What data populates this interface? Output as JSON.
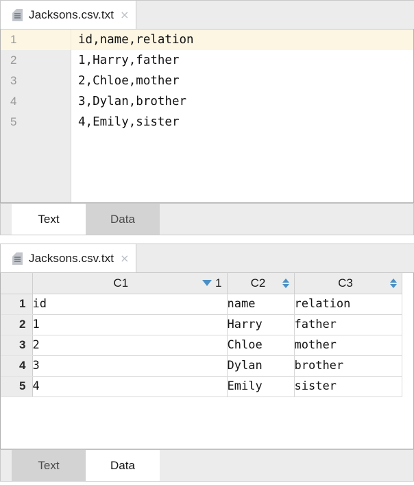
{
  "app": {
    "file_icon_name": "text-file-icon"
  },
  "text_panel": {
    "tab": {
      "title": "Jacksons.csv.txt",
      "close_label": "×"
    },
    "editor": {
      "lines": [
        {
          "number": "1",
          "content": "id,name,relation",
          "current": true
        },
        {
          "number": "2",
          "content": "1,Harry,father",
          "current": false
        },
        {
          "number": "3",
          "content": "2,Chloe,mother",
          "current": false
        },
        {
          "number": "4",
          "content": "3,Dylan,brother",
          "current": false
        },
        {
          "number": "5",
          "content": "4,Emily,sister",
          "current": false
        }
      ],
      "current_line_highlight_color": "#fdf6e3",
      "gutter_color": "#ececec"
    },
    "view_tabs": [
      {
        "label": "Text",
        "active": true
      },
      {
        "label": "Data",
        "active": false
      }
    ]
  },
  "data_panel": {
    "tab": {
      "title": "Jacksons.csv.txt",
      "close_label": "×"
    },
    "table": {
      "columns": [
        {
          "label": "C1",
          "sort": "descending",
          "sort_rank": "1"
        },
        {
          "label": "C2",
          "sort": "none",
          "sort_rank": ""
        },
        {
          "label": "C3",
          "sort": "none",
          "sort_rank": ""
        }
      ],
      "rows": [
        {
          "number": "1",
          "cells": [
            "id",
            "name",
            "relation"
          ]
        },
        {
          "number": "2",
          "cells": [
            "1",
            "Harry",
            "father"
          ]
        },
        {
          "number": "3",
          "cells": [
            "2",
            "Chloe",
            "mother"
          ]
        },
        {
          "number": "4",
          "cells": [
            "3",
            "Dylan",
            "brother"
          ]
        },
        {
          "number": "5",
          "cells": [
            "4",
            "Emily",
            "sister"
          ]
        }
      ],
      "sort_indicator_color": "#4a90c4"
    },
    "view_tabs": [
      {
        "label": "Text",
        "active": false
      },
      {
        "label": "Data",
        "active": true
      }
    ]
  }
}
